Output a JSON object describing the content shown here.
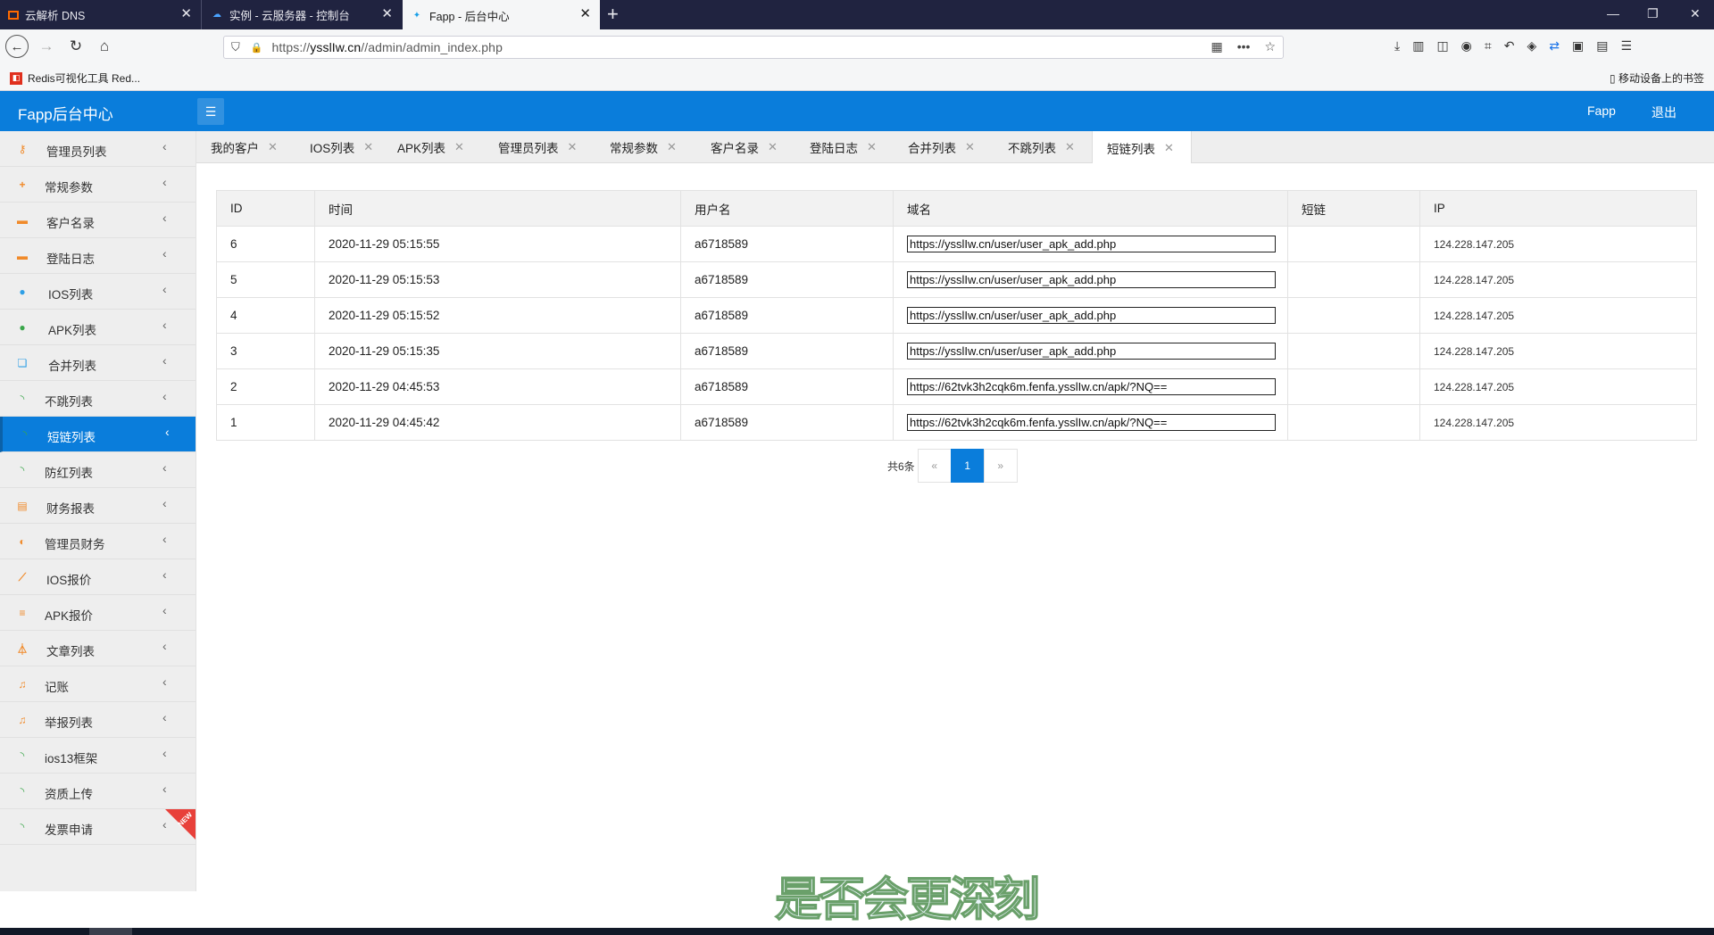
{
  "browser": {
    "tabs": [
      {
        "title": "云解析 DNS",
        "icon": "aliyun-icon"
      },
      {
        "title": "实例 - 云服务器 - 控制台",
        "icon": "cloud-icon"
      },
      {
        "title": "Fapp - 后台中心",
        "icon": "fapp-icon"
      }
    ],
    "url_prefix": "https://",
    "url_host": "ysslIw.cn",
    "url_path": "//admin/admin_index.php",
    "bookmark": "Redis可视化工具 Red...",
    "mobile_bookmarks": "移动设备上的书签"
  },
  "header": {
    "title": "Fapp后台中心",
    "user": "Fapp",
    "logout": "退出"
  },
  "sidebar": {
    "items": [
      {
        "label": "管理员列表",
        "icon": "key-icon",
        "color": "#f08a2a"
      },
      {
        "label": "常规参数",
        "icon": "plus-icon",
        "color": "#f08a2a"
      },
      {
        "label": "客户名录",
        "icon": "briefcase-icon",
        "color": "#f08a2a"
      },
      {
        "label": "登陆日志",
        "icon": "briefcase-icon",
        "color": "#f08a2a"
      },
      {
        "label": "IOS列表",
        "icon": "apple-icon",
        "color": "#2e9fe6"
      },
      {
        "label": "APK列表",
        "icon": "android-icon",
        "color": "#3aa64a"
      },
      {
        "label": "合并列表",
        "icon": "copy-icon",
        "color": "#2e9fe6"
      },
      {
        "label": "不跳列表",
        "icon": "rss-icon",
        "color": "#3aa64a"
      },
      {
        "label": "短链列表",
        "icon": "rss-icon",
        "color": "#3aa64a"
      },
      {
        "label": "防红列表",
        "icon": "rss-icon",
        "color": "#3aa64a"
      },
      {
        "label": "财务报表",
        "icon": "files-icon",
        "color": "#f08a2a"
      },
      {
        "label": "管理员财务",
        "icon": "coins-icon",
        "color": "#f08a2a"
      },
      {
        "label": "IOS报价",
        "icon": "magic-wand-icon",
        "color": "#f08a2a"
      },
      {
        "label": "APK报价",
        "icon": "bars-icon",
        "color": "#f08a2a"
      },
      {
        "label": "文章列表",
        "icon": "flask-icon",
        "color": "#f08a2a"
      },
      {
        "label": "记账",
        "icon": "music-icon",
        "color": "#f08a2a"
      },
      {
        "label": "举报列表",
        "icon": "music-icon",
        "color": "#f08a2a"
      },
      {
        "label": "ios13框架",
        "icon": "rss-icon",
        "color": "#3aa64a"
      },
      {
        "label": "资质上传",
        "icon": "rss-icon",
        "color": "#3aa64a"
      },
      {
        "label": "发票申请",
        "icon": "rss-icon",
        "color": "#3aa64a"
      }
    ],
    "active_index": 8,
    "new_badge": "NEW"
  },
  "content_tabs": [
    "我的客户",
    "IOS列表",
    "APK列表",
    "管理员列表",
    "常规参数",
    "客户名录",
    "登陆日志",
    "合并列表",
    "不跳列表",
    "短链列表"
  ],
  "table": {
    "columns": [
      "ID",
      "时间",
      "用户名",
      "域名",
      "短链",
      "IP"
    ],
    "rows": [
      {
        "id": "6",
        "time": "2020-11-29 05:15:55",
        "user": "a6718589",
        "domain": "https://ysslIw.cn/user/user_apk_add.php",
        "short": "",
        "ip": "124.228.147.205"
      },
      {
        "id": "5",
        "time": "2020-11-29 05:15:53",
        "user": "a6718589",
        "domain": "https://ysslIw.cn/user/user_apk_add.php",
        "short": "",
        "ip": "124.228.147.205"
      },
      {
        "id": "4",
        "time": "2020-11-29 05:15:52",
        "user": "a6718589",
        "domain": "https://ysslIw.cn/user/user_apk_add.php",
        "short": "",
        "ip": "124.228.147.205"
      },
      {
        "id": "3",
        "time": "2020-11-29 05:15:35",
        "user": "a6718589",
        "domain": "https://ysslIw.cn/user/user_apk_add.php",
        "short": "",
        "ip": "124.228.147.205"
      },
      {
        "id": "2",
        "time": "2020-11-29 04:45:53",
        "user": "a6718589",
        "domain": "https://62tvk3h2cqk6m.fenfa.ysslIw.cn/apk/?NQ==",
        "short": "",
        "ip": "124.228.147.205"
      },
      {
        "id": "1",
        "time": "2020-11-29 04:45:42",
        "user": "a6718589",
        "domain": "https://62tvk3h2cqk6m.fenfa.ysslIw.cn/apk/?NQ==",
        "short": "",
        "ip": "124.228.147.205"
      }
    ]
  },
  "pagination": {
    "total": "共6条",
    "prev": "«",
    "current": "1",
    "next": "»"
  },
  "overlay_caption": "是否会更深刻",
  "colors": {
    "brand": "#0a7ddb",
    "chrome": "#202340"
  }
}
